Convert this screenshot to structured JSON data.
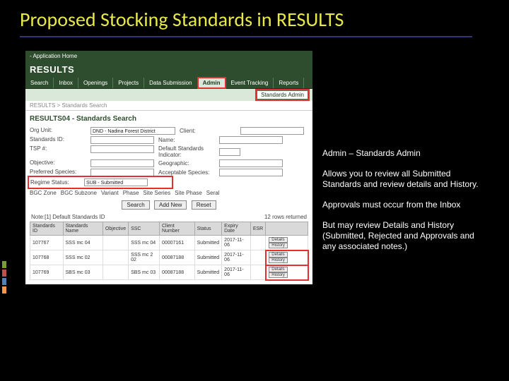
{
  "slide_title": "Proposed Stocking Standards in RESULTS",
  "app": {
    "home_link": "- Application Home",
    "header": "RESULTS",
    "tabs": [
      "Search",
      "Inbox",
      "Openings",
      "Projects",
      "Data Submission",
      "Admin",
      "Event Tracking",
      "Reports"
    ],
    "active_tab": "Admin",
    "subnav_item": "Standards Admin",
    "breadcrumb": "RESULTS > Standards Search",
    "page_sub": "RESULTS04 - Standards Search"
  },
  "form": {
    "labels": {
      "org_unit": "Org Unit:",
      "client": "Client:",
      "standards_id": "Standards ID:",
      "name": "Name:",
      "tsp": "TSP #:",
      "default_indicator": "Default Standards Indicator:",
      "objective": "Objective:",
      "geographic": "Geographic:",
      "preferred_species": "Preferred Species:",
      "acceptable_species": "Acceptable Species:",
      "regime_status": "Regime Status:"
    },
    "values": {
      "org_unit": "DND - Nadina Forest District",
      "regime_status": "SUB - Submitted"
    },
    "zone_headers": {
      "bgc_zone": "BGC Zone",
      "bgc_subzone": "BGC Subzone",
      "variant": "Variant",
      "phase": "Phase",
      "site_series": "Site Series",
      "site_phase": "Site Phase",
      "seral": "Seral"
    },
    "buttons": {
      "search": "Search",
      "add_new": "Add New",
      "reset": "Reset"
    }
  },
  "results": {
    "note_label": "Note:[1] Default Standards ID",
    "rows_returned": "12 rows returned",
    "columns": [
      "Standards ID",
      "Standards Name",
      "Objective",
      "SSC",
      "Client Number",
      "Status",
      "Expiry Date",
      "ESR"
    ],
    "action_buttons": {
      "details": "Details",
      "history": "History"
    },
    "rows": [
      {
        "id": "107767",
        "name": "SSS mc 04",
        "objective": "",
        "ssc": "SSS mc 04",
        "client": "00007161",
        "status": "Submitted",
        "expiry": "2017-11-06",
        "highlight": false
      },
      {
        "id": "107768",
        "name": "SSS mc 02",
        "objective": "",
        "ssc": "SSS mc 2 02",
        "client": "00087188",
        "status": "Submitted",
        "expiry": "2017-11-06",
        "highlight": true
      },
      {
        "id": "107769",
        "name": "SBS mc 03",
        "objective": "",
        "ssc": "SBS mc 03",
        "client": "00087188",
        "status": "Submitted",
        "expiry": "2017-11-06",
        "highlight": true
      }
    ]
  },
  "callouts": {
    "c1": "Admin – Standards Admin",
    "c2": "Allows you to review all Submitted Standards and review details and History.",
    "c3": "Approvals must occur from the Inbox",
    "c4": "But may review Details and History (Submitted, Rejected and Approvals and any associated notes.)"
  },
  "accent_colors": [
    "#7a9e2e",
    "#c0504d",
    "#4f81bd",
    "#f79646"
  ]
}
